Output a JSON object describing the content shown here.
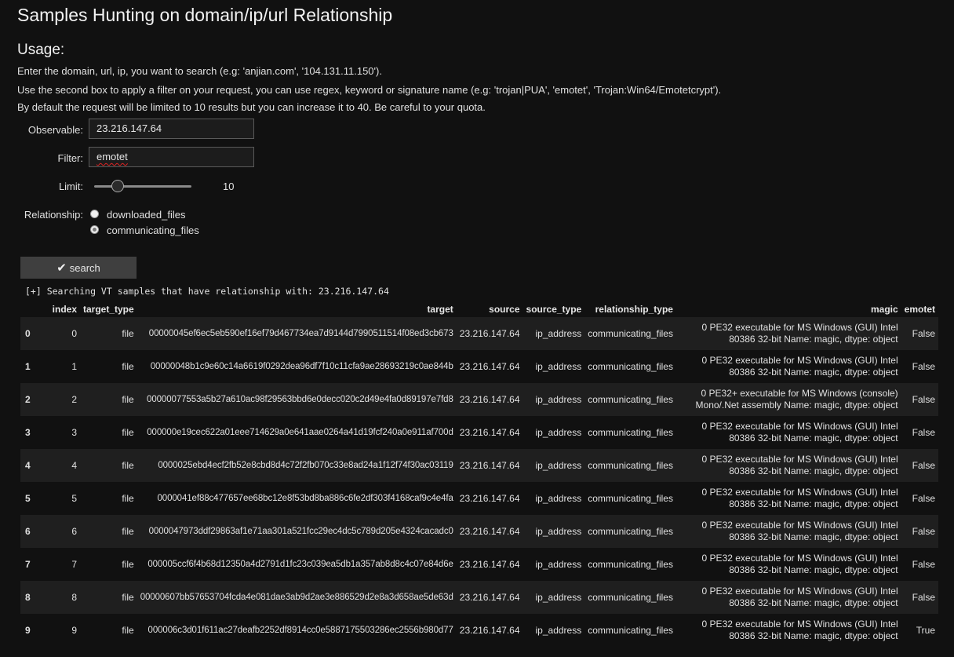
{
  "page": {
    "title": "Samples Hunting on domain/ip/url Relationship",
    "usage_heading": "Usage:",
    "usage_lines": [
      "Enter the domain, url, ip, you want to search (e.g: 'anjian.com', '104.131.11.150').",
      "Use the second box to apply a filter on your request, you can use regex, keyword or signature name (e.g: 'trojan|PUA', 'emotet', 'Trojan:Win64/Emotetcrypt').",
      "By default the request will be limited to 10 results but you can increase it to 40. Be careful to your quota."
    ]
  },
  "form": {
    "observable_label": "Observable:",
    "observable_value": "23.216.147.64",
    "filter_label": "Filter:",
    "filter_value": "emotet",
    "limit_label": "Limit:",
    "limit_value": "10",
    "limit_min": 10,
    "limit_max": 40,
    "relationship_label": "Relationship:",
    "relationship_options": [
      "downloaded_files",
      "communicating_files"
    ],
    "relationship_selected": "communicating_files",
    "search_label": "search"
  },
  "log": "[+] Searching VT samples that have relationship with: 23.216.147.64",
  "table": {
    "columns": [
      "",
      "index",
      "target_type",
      "target",
      "source",
      "source_type",
      "relationship_type",
      "magic",
      "emotet"
    ],
    "rows": [
      [
        "0",
        "0",
        "file",
        "00000045ef6ec5eb590ef16ef79d467734ea7d9144d7990511514f08ed3cb673",
        "23.216.147.64",
        "ip_address",
        "communicating_files",
        "0 PE32 executable for MS Windows (GUI) Intel 80386 32-bit Name: magic, dtype: object",
        "False"
      ],
      [
        "1",
        "1",
        "file",
        "00000048b1c9e60c14a6619f0292dea96df7f10c11cfa9ae28693219c0ae844b",
        "23.216.147.64",
        "ip_address",
        "communicating_files",
        "0 PE32 executable for MS Windows (GUI) Intel 80386 32-bit Name: magic, dtype: object",
        "False"
      ],
      [
        "2",
        "2",
        "file",
        "00000077553a5b27a610ac98f29563bbd6e0decc020c2d49e4fa0d89197e7fd8",
        "23.216.147.64",
        "ip_address",
        "communicating_files",
        "0 PE32+ executable for MS Windows (console) Mono/.Net assembly Name: magic, dtype: object",
        "False"
      ],
      [
        "3",
        "3",
        "file",
        "000000e19cec622a01eee714629a0e641aae0264a41d19fcf240a0e911af700d",
        "23.216.147.64",
        "ip_address",
        "communicating_files",
        "0 PE32 executable for MS Windows (GUI) Intel 80386 32-bit Name: magic, dtype: object",
        "False"
      ],
      [
        "4",
        "4",
        "file",
        "0000025ebd4ecf2fb52e8cbd8d4c72f2fb070c33e8ad24a1f12f74f30ac03119",
        "23.216.147.64",
        "ip_address",
        "communicating_files",
        "0 PE32 executable for MS Windows (GUI) Intel 80386 32-bit Name: magic, dtype: object",
        "False"
      ],
      [
        "5",
        "5",
        "file",
        "0000041ef88c477657ee68bc12e8f53bd8ba886c6fe2df303f4168caf9c4e4fa",
        "23.216.147.64",
        "ip_address",
        "communicating_files",
        "0 PE32 executable for MS Windows (GUI) Intel 80386 32-bit Name: magic, dtype: object",
        "False"
      ],
      [
        "6",
        "6",
        "file",
        "0000047973ddf29863af1e71aa301a521fcc29ec4dc5c789d205e4324cacadc0",
        "23.216.147.64",
        "ip_address",
        "communicating_files",
        "0 PE32 executable for MS Windows (GUI) Intel 80386 32-bit Name: magic, dtype: object",
        "False"
      ],
      [
        "7",
        "7",
        "file",
        "000005ccf6f4b68d12350a4d2791d1fc23c039ea5db1a357ab8d8c4c07e84d6e",
        "23.216.147.64",
        "ip_address",
        "communicating_files",
        "0 PE32 executable for MS Windows (GUI) Intel 80386 32-bit Name: magic, dtype: object",
        "False"
      ],
      [
        "8",
        "8",
        "file",
        "00000607bb57653704fcda4e081dae3ab9d2ae3e886529d2e8a3d658ae5de63d",
        "23.216.147.64",
        "ip_address",
        "communicating_files",
        "0 PE32 executable for MS Windows (GUI) Intel 80386 32-bit Name: magic, dtype: object",
        "False"
      ],
      [
        "9",
        "9",
        "file",
        "000006c3d01f611ac27deafb2252df8914cc0e5887175503286ec2556b980d77",
        "23.216.147.64",
        "ip_address",
        "communicating_files",
        "0 PE32 executable for MS Windows (GUI) Intel 80386 32-bit Name: magic, dtype: object",
        "True"
      ]
    ]
  }
}
